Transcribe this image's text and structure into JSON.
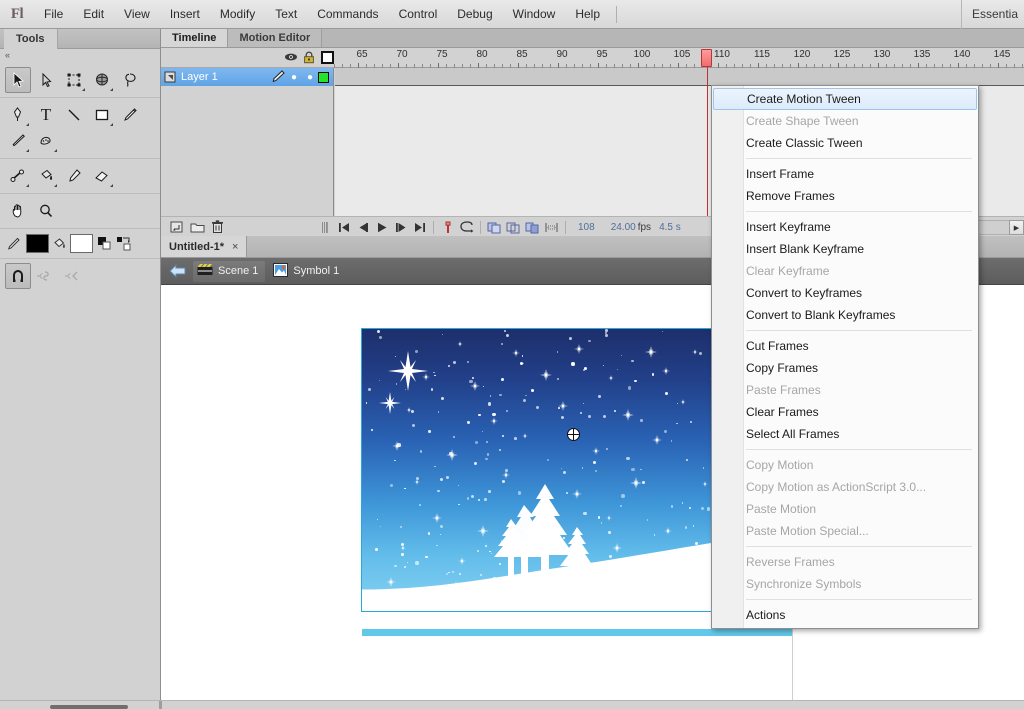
{
  "app": {
    "logo": "Fl",
    "workspace": "Essentia"
  },
  "menubar": {
    "items": [
      {
        "label": "File"
      },
      {
        "label": "Edit"
      },
      {
        "label": "View"
      },
      {
        "label": "Insert"
      },
      {
        "label": "Modify"
      },
      {
        "label": "Text"
      },
      {
        "label": "Commands"
      },
      {
        "label": "Control"
      },
      {
        "label": "Debug"
      },
      {
        "label": "Window"
      },
      {
        "label": "Help"
      }
    ]
  },
  "tools": {
    "panel_title": "Tools",
    "collapse_glyph": "«",
    "groups": [
      {
        "items": [
          {
            "name": "selection-tool",
            "selected": true,
            "arrow": false
          },
          {
            "name": "subselection-tool",
            "selected": false,
            "arrow": false
          },
          {
            "name": "free-transform-tool",
            "selected": false,
            "arrow": true
          },
          {
            "name": "3d-rotation-tool",
            "selected": false,
            "arrow": true
          },
          {
            "name": "lasso-tool",
            "selected": false,
            "arrow": false
          }
        ]
      },
      {
        "items": [
          {
            "name": "pen-tool",
            "selected": false,
            "arrow": true
          },
          {
            "name": "text-tool",
            "selected": false,
            "arrow": false
          },
          {
            "name": "line-tool",
            "selected": false,
            "arrow": false
          },
          {
            "name": "rectangle-tool",
            "selected": false,
            "arrow": true
          },
          {
            "name": "pencil-tool",
            "selected": false,
            "arrow": false
          },
          {
            "name": "brush-tool",
            "selected": false,
            "arrow": true
          },
          {
            "name": "deco-tool",
            "selected": false,
            "arrow": true
          }
        ]
      },
      {
        "items": [
          {
            "name": "bone-tool",
            "selected": false,
            "arrow": true
          },
          {
            "name": "paint-bucket-tool",
            "selected": false,
            "arrow": true
          },
          {
            "name": "eyedropper-tool",
            "selected": false,
            "arrow": false
          },
          {
            "name": "eraser-tool",
            "selected": false,
            "arrow": false
          }
        ]
      },
      {
        "items": [
          {
            "name": "hand-tool",
            "selected": false,
            "arrow": false
          },
          {
            "name": "zoom-tool",
            "selected": false,
            "arrow": false
          }
        ]
      }
    ],
    "colors": {
      "stroke_label": "stroke-color",
      "stroke_hex": "#000000",
      "fill_label": "fill-color",
      "fill_hex": "#ffffff"
    },
    "options": [
      {
        "name": "snap-to-objects",
        "selected": true
      },
      {
        "name": "smooth-option",
        "selected": false
      },
      {
        "name": "straighten-option",
        "selected": false
      }
    ]
  },
  "timeline": {
    "tabs": [
      {
        "label": "Timeline",
        "active": true
      },
      {
        "label": "Motion Editor",
        "active": false
      }
    ],
    "column_icons": [
      "eye-icon",
      "lock-icon",
      "outline-square-icon"
    ],
    "ruler": {
      "labels": [
        65,
        70,
        75,
        80,
        85,
        90,
        95,
        100,
        105,
        110,
        115,
        120,
        125,
        130,
        135,
        140,
        145
      ],
      "first_frame": 62,
      "frame_width": 8.0,
      "playhead_frame": 108
    },
    "layers": [
      {
        "name": "Layer 1",
        "selected": true,
        "editable_icon": "pencil-icon",
        "visible": true,
        "locked": false,
        "outline_color": "#27e327"
      }
    ],
    "status": {
      "current_frame": "108",
      "fps": "24.00",
      "fps_unit": "fps",
      "elapsed": "4.5 s",
      "buttons": [
        {
          "name": "new-layer-button",
          "glyph": "new-layer"
        },
        {
          "name": "new-folder-button",
          "glyph": "folder"
        },
        {
          "name": "delete-layer-button",
          "glyph": "trash"
        }
      ],
      "playback": [
        {
          "name": "go-to-first-frame-button"
        },
        {
          "name": "step-back-one-frame-button"
        },
        {
          "name": "play-button"
        },
        {
          "name": "step-forward-one-frame-button"
        },
        {
          "name": "go-to-last-frame-button"
        }
      ],
      "toggles": [
        {
          "name": "center-frame-button"
        },
        {
          "name": "loop-playback-button"
        },
        {
          "name": "onion-skin-button"
        },
        {
          "name": "onion-skin-outlines-button"
        },
        {
          "name": "edit-multiple-frames-button"
        },
        {
          "name": "modify-onion-markers-button"
        }
      ]
    }
  },
  "document": {
    "tab_label": "Untitled-1*",
    "tab_close": "×"
  },
  "edit_bar": {
    "back_button": "back-arrow",
    "crumbs": [
      {
        "label": "Scene 1",
        "icon": "scene-icon"
      },
      {
        "label": "Symbol 1",
        "icon": "symbol-icon"
      }
    ]
  },
  "stage": {
    "artwork_name": "winter-night-scene",
    "colors": {
      "sky_top": "#1d2f6b",
      "sky_bottom": "#86d3f2",
      "snow": "#ffffff",
      "selection_outline": "#2aa7e0",
      "accent_bar": "#62c8ea"
    },
    "registration_marker": "registration-crosshair"
  },
  "context_menu": {
    "items": [
      {
        "label": "Create Motion Tween",
        "disabled": false,
        "highlighted": true
      },
      {
        "label": "Create Shape Tween",
        "disabled": true,
        "highlighted": false
      },
      {
        "label": "Create Classic Tween",
        "disabled": false,
        "highlighted": false
      },
      {
        "separator": true
      },
      {
        "label": "Insert Frame",
        "disabled": false,
        "highlighted": false
      },
      {
        "label": "Remove Frames",
        "disabled": false,
        "highlighted": false
      },
      {
        "separator": true
      },
      {
        "label": "Insert Keyframe",
        "disabled": false,
        "highlighted": false
      },
      {
        "label": "Insert Blank Keyframe",
        "disabled": false,
        "highlighted": false
      },
      {
        "label": "Clear Keyframe",
        "disabled": true,
        "highlighted": false
      },
      {
        "label": "Convert to Keyframes",
        "disabled": false,
        "highlighted": false
      },
      {
        "label": "Convert to Blank Keyframes",
        "disabled": false,
        "highlighted": false
      },
      {
        "separator": true
      },
      {
        "label": "Cut Frames",
        "disabled": false,
        "highlighted": false
      },
      {
        "label": "Copy Frames",
        "disabled": false,
        "highlighted": false
      },
      {
        "label": "Paste Frames",
        "disabled": true,
        "highlighted": false
      },
      {
        "label": "Clear Frames",
        "disabled": false,
        "highlighted": false
      },
      {
        "label": "Select All Frames",
        "disabled": false,
        "highlighted": false
      },
      {
        "separator": true
      },
      {
        "label": "Copy Motion",
        "disabled": true,
        "highlighted": false
      },
      {
        "label": "Copy Motion as ActionScript 3.0...",
        "disabled": true,
        "highlighted": false
      },
      {
        "label": "Paste Motion",
        "disabled": true,
        "highlighted": false
      },
      {
        "label": "Paste Motion Special...",
        "disabled": true,
        "highlighted": false
      },
      {
        "separator": true
      },
      {
        "label": "Reverse Frames",
        "disabled": true,
        "highlighted": false
      },
      {
        "label": "Synchronize Symbols",
        "disabled": true,
        "highlighted": false
      },
      {
        "separator": true
      },
      {
        "label": "Actions",
        "disabled": false,
        "highlighted": false
      }
    ]
  }
}
